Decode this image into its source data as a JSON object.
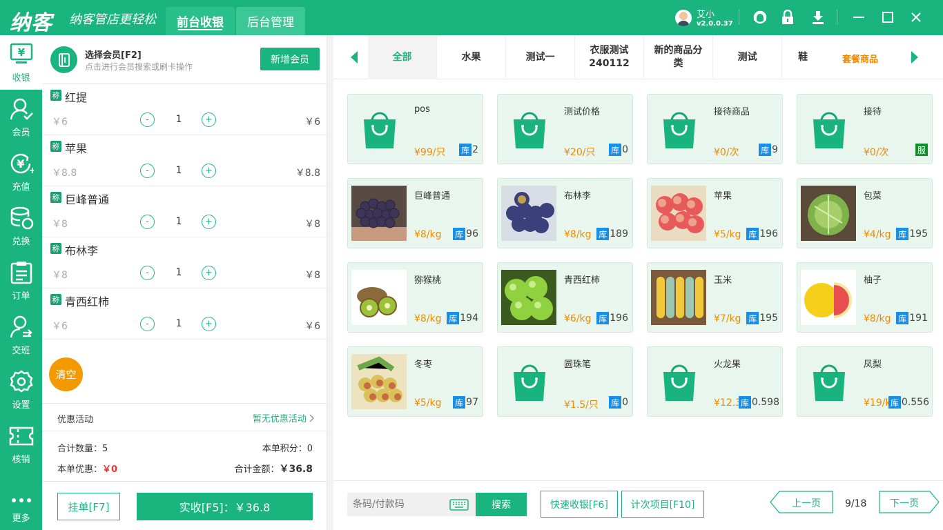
{
  "app": {
    "logo": "纳客",
    "slogan": "纳客管店更轻松",
    "tabs": [
      {
        "label": "前台收银"
      },
      {
        "label": "后台管理"
      }
    ],
    "user": {
      "name": "艾小",
      "version": "v2.0.0.37"
    }
  },
  "sidebar": {
    "items": [
      {
        "label": "收银",
        "icon": "cashier-icon"
      },
      {
        "label": "会员",
        "icon": "member-icon"
      },
      {
        "label": "充值",
        "icon": "recharge-icon"
      },
      {
        "label": "兑换",
        "icon": "exchange-icon"
      },
      {
        "label": "订单",
        "icon": "order-icon"
      },
      {
        "label": "交班",
        "icon": "shift-icon"
      },
      {
        "label": "设置",
        "icon": "settings-icon"
      },
      {
        "label": "核销",
        "icon": "ticket-icon"
      },
      {
        "label": "更多",
        "icon": "more-icon"
      }
    ]
  },
  "member": {
    "title": "选择会员[F2]",
    "subtitle": "点击进行会员搜索或刷卡操作",
    "add_label": "新增会员"
  },
  "cart": {
    "badge": "称",
    "items": [
      {
        "name": "红提",
        "price": "￥6",
        "qty": "1",
        "subtotal": "￥6"
      },
      {
        "name": "苹果",
        "price": "￥8.8",
        "qty": "1",
        "subtotal": "￥8.8"
      },
      {
        "name": "巨峰普通",
        "price": "￥8",
        "qty": "1",
        "subtotal": "￥8"
      },
      {
        "name": "布林李",
        "price": "￥8",
        "qty": "1",
        "subtotal": "￥8"
      },
      {
        "name": "青西红柿",
        "price": "￥6",
        "qty": "1",
        "subtotal": "￥6"
      }
    ],
    "minus": "-",
    "plus": "+",
    "clear_label": "清空"
  },
  "promo": {
    "label": "优惠活动",
    "value": "暂无优惠活动"
  },
  "summary": {
    "count_label": "合计数量：",
    "count": "5",
    "points_label": "本单积分：",
    "points": "0",
    "discount_label": "本单优惠：",
    "discount": "￥0",
    "total_label": "合计金额：",
    "total": "￥36.8"
  },
  "actions": {
    "hang_label": "挂单[F7]",
    "pay_label": "实收[F5]：￥36.8"
  },
  "categories": [
    {
      "label": "全部"
    },
    {
      "label": "水果"
    },
    {
      "label": "测试一"
    },
    {
      "label": "衣服测试240112"
    },
    {
      "label": "新的商品分类"
    },
    {
      "label": "测试"
    },
    {
      "label": "鞋"
    }
  ],
  "package_label": "套餐商品",
  "products": [
    {
      "name": "pos",
      "price": "¥99/只",
      "stock": "2",
      "img": "bag"
    },
    {
      "name": "测试价格",
      "price": "¥20/只",
      "stock": "0",
      "img": "bag"
    },
    {
      "name": "接待商品",
      "price": "¥0/次",
      "stock": "9",
      "img": "bag"
    },
    {
      "name": "接待",
      "price": "¥0/次",
      "service": "服",
      "img": "bag"
    },
    {
      "name": "巨峰普通",
      "price": "¥8/kg",
      "stock": "96",
      "img": "grape"
    },
    {
      "name": "布林李",
      "price": "¥8/kg",
      "stock": "189",
      "img": "plum"
    },
    {
      "name": "苹果",
      "price": "¥5/kg",
      "stock": "196",
      "img": "apple"
    },
    {
      "name": "包菜",
      "price": "¥4/kg",
      "stock": "195",
      "img": "cabbage"
    },
    {
      "name": "猕猴桃",
      "price": "¥8/kg",
      "stock": "194",
      "img": "kiwi"
    },
    {
      "name": "青西红柿",
      "price": "¥6/kg",
      "stock": "196",
      "img": "greentomato"
    },
    {
      "name": "玉米",
      "price": "¥7/kg",
      "stock": "195",
      "img": "corn"
    },
    {
      "name": "柚子",
      "price": "¥8/kg",
      "stock": "191",
      "img": "pomelo"
    },
    {
      "name": "冬枣",
      "price": "¥5/kg",
      "stock": "97",
      "img": "jujube"
    },
    {
      "name": "圆珠笔",
      "price": "¥1.5/只",
      "stock": "0",
      "img": "bag"
    },
    {
      "name": "火龙果",
      "price": "¥12.3",
      "stock": "0.598",
      "img": "bag"
    },
    {
      "name": "凤梨",
      "price": "¥19/k",
      "stock": "0.556",
      "img": "bag"
    }
  ],
  "stock_badge": "库",
  "bottom": {
    "scan_placeholder": "条码/付款码",
    "search_label": "搜索",
    "quick_label": "快速收银[F6]",
    "count_item_label": "计次项目[F10]",
    "prev_label": "上一页",
    "next_label": "下一页",
    "page": "9/18"
  }
}
